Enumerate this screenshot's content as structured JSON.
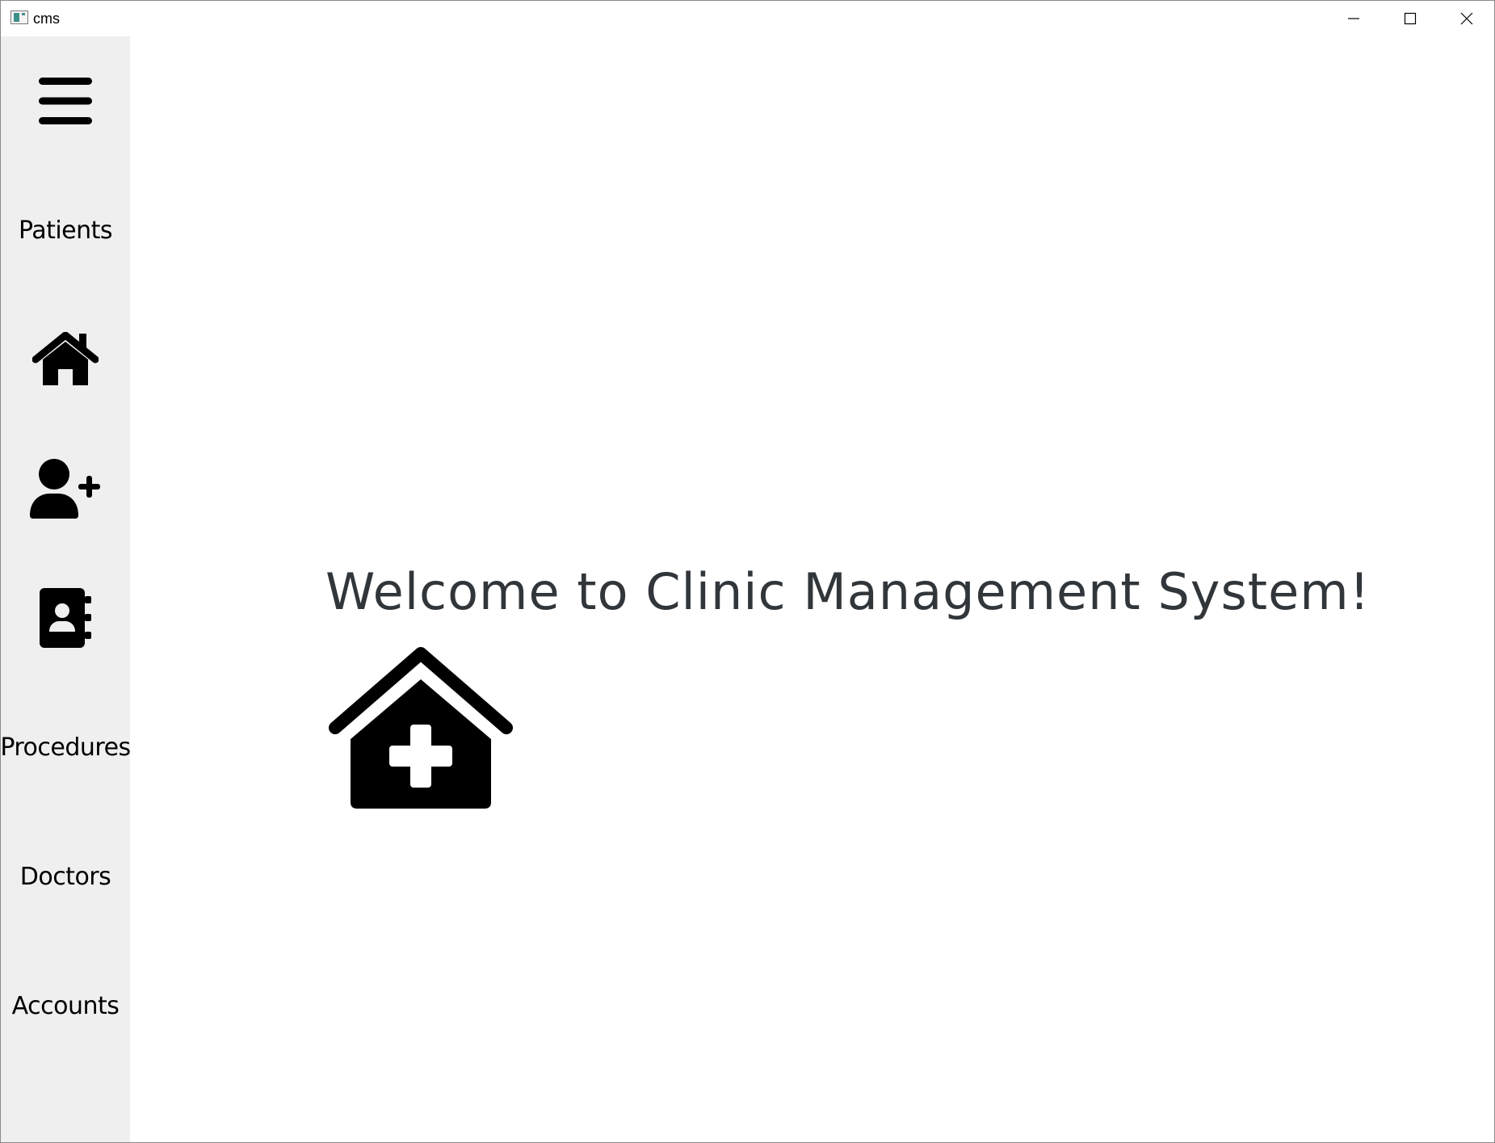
{
  "window": {
    "title": "cms",
    "controls": {
      "minimize": "minimize-icon",
      "maximize": "maximize-icon",
      "close": "close-icon"
    }
  },
  "sidebar": {
    "items": [
      {
        "type": "icon",
        "icon": "hamburger-menu-icon"
      },
      {
        "type": "text",
        "label": "Patients"
      },
      {
        "type": "icon",
        "icon": "home-icon"
      },
      {
        "type": "icon",
        "icon": "user-plus-icon"
      },
      {
        "type": "icon",
        "icon": "address-book-icon"
      },
      {
        "type": "text",
        "label": "Procedures"
      },
      {
        "type": "text",
        "label": "Doctors"
      },
      {
        "type": "text",
        "label": "Accounts"
      }
    ]
  },
  "main": {
    "welcome_text": "Welcome to Clinic Management System!",
    "hero_icon": "clinic-medical-icon"
  },
  "colors": {
    "sidebar_bg": "#efefef",
    "welcome_text": "#31363b",
    "icon": "#000000"
  }
}
